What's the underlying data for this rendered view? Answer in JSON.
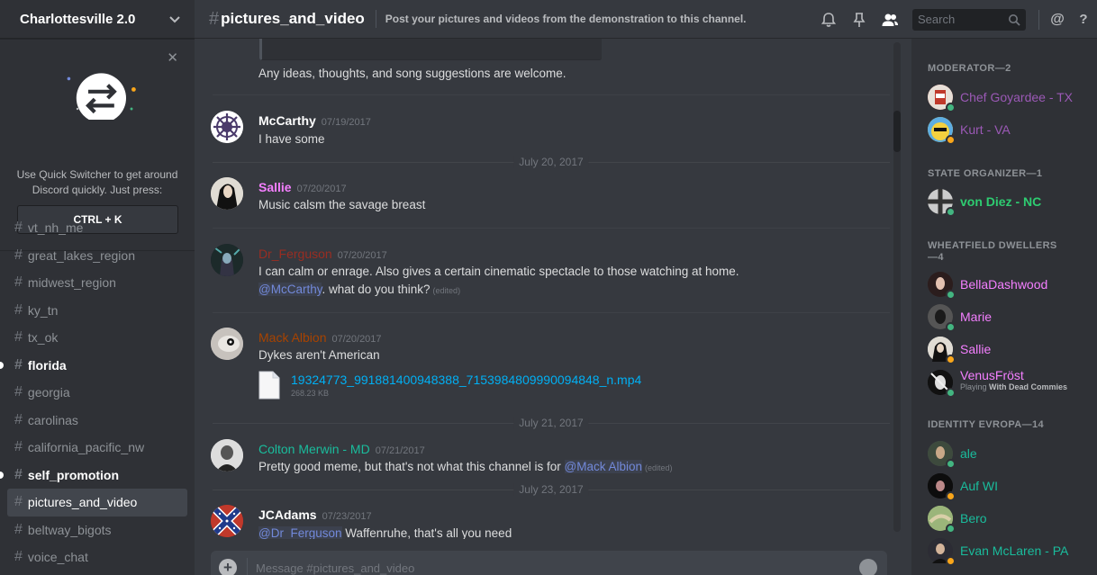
{
  "guild": {
    "name": "Charlottesville 2.0"
  },
  "quick_switcher": {
    "text": "Use Quick Switcher to get around Discord quickly. Just press:",
    "shortcut": "CTRL + K"
  },
  "channels": [
    {
      "name": "vt_nh_me",
      "state": "normal"
    },
    {
      "name": "great_lakes_region",
      "state": "normal"
    },
    {
      "name": "midwest_region",
      "state": "normal"
    },
    {
      "name": "ky_tn",
      "state": "normal"
    },
    {
      "name": "tx_ok",
      "state": "normal"
    },
    {
      "name": "florida",
      "state": "unread"
    },
    {
      "name": "georgia",
      "state": "normal"
    },
    {
      "name": "carolinas",
      "state": "normal"
    },
    {
      "name": "california_pacific_nw",
      "state": "normal"
    },
    {
      "name": "self_promotion",
      "state": "unread"
    },
    {
      "name": "pictures_and_video",
      "state": "active"
    },
    {
      "name": "beltway_bigots",
      "state": "normal"
    },
    {
      "name": "voice_chat",
      "state": "normal"
    }
  ],
  "topbar": {
    "channel": "pictures_and_video",
    "topic": "Post your pictures and videos from the demonstration to this channel.",
    "search_placeholder": "Search"
  },
  "messages": {
    "continuation": "Any ideas, thoughts, and song suggestions are welcome.",
    "m1": {
      "user": "McCarthy",
      "color": "#ffffff",
      "ts": "07/19/2017",
      "text": "I have some"
    },
    "day1": "July 20, 2017",
    "m2": {
      "user": "Sallie",
      "color": "#f47fff",
      "ts": "07/20/2017",
      "text": "Music calsm the savage breast"
    },
    "m3": {
      "user": "Dr_Ferguson",
      "color": "#992d22",
      "ts": "07/20/2017",
      "text": "I can calm or enrage. Also gives a certain cinematic spectacle to those watching at home.",
      "mention": "@McCarthy",
      "text2": ". what do you think?",
      "edited": "(edited)"
    },
    "m4": {
      "user": "Mack Albion",
      "color": "#a84300",
      "ts": "07/20/2017",
      "text": "Dykes aren't American",
      "file_name": "19324773_991881400948388_7153984809990094848_n.mp4",
      "file_size": "268.23 KB"
    },
    "day2": "July 21, 2017",
    "m5": {
      "user": "Colton Merwin - MD",
      "color": "#1abc9c",
      "ts": "07/21/2017",
      "text": "Pretty good meme, but that's not what this channel is for ",
      "mention": "@Mack Albion",
      "edited": "(edited)"
    },
    "day3": "July 23, 2017",
    "m6": {
      "user": "JCAdams",
      "color": "#ffffff",
      "ts": "07/23/2017",
      "mention": "@Dr_Ferguson",
      "text": " Waffenruhe, that's all you need"
    }
  },
  "composer": {
    "placeholder": "Message #pictures_and_video"
  },
  "members": {
    "roles": [
      {
        "title": "MODERATOR—2"
      },
      {
        "title": "STATE ORGANIZER—1"
      },
      {
        "title": "WHEATFIELD DWELLERS—4"
      },
      {
        "title": "IDENTITY EVROPA—14"
      }
    ],
    "list": [
      {
        "name": "Chef Goyardee - TX",
        "color": "#9b59b6",
        "status": "#43b581"
      },
      {
        "name": "Kurt - VA",
        "color": "#9b59b6",
        "status": "#faa61a"
      },
      {
        "name": "von Diez - NC",
        "color": "#2ecc71",
        "status": "#43b581"
      },
      {
        "name": "BellaDashwood",
        "color": "#f47fff",
        "status": "#43b581"
      },
      {
        "name": "Marie",
        "color": "#f47fff",
        "status": "#43b581"
      },
      {
        "name": "Sallie",
        "color": "#f47fff",
        "status": "#faa61a"
      },
      {
        "name": "VenusFröst",
        "color": "#f47fff",
        "status": "#43b581",
        "activity_prefix": "Playing ",
        "activity": "With Dead Commies"
      },
      {
        "name": "ale",
        "color": "#1abc9c",
        "status": "#43b581"
      },
      {
        "name": "Auf WI",
        "color": "#1abc9c",
        "status": "#faa61a"
      },
      {
        "name": "Bero",
        "color": "#1abc9c",
        "status": "#43b581"
      },
      {
        "name": "Evan McLaren - PA",
        "color": "#1abc9c",
        "status": "#faa61a"
      }
    ]
  }
}
